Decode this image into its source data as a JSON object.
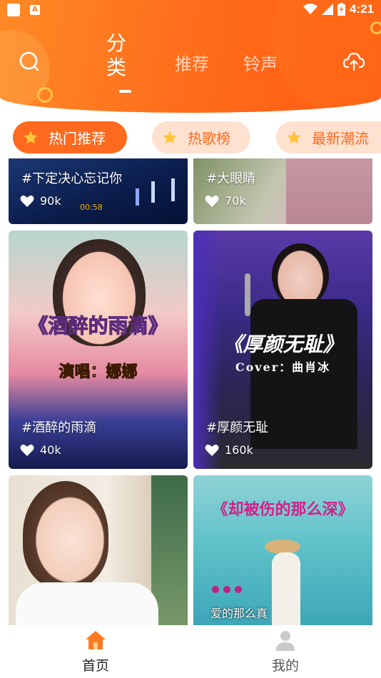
{
  "status_bar": {
    "time": "4:21",
    "notification_icon": "A"
  },
  "header": {
    "tabs": [
      {
        "label": "分类",
        "active": true
      },
      {
        "label": "推荐",
        "active": false
      },
      {
        "label": "铃声",
        "active": false
      }
    ],
    "search_icon": "search-icon",
    "upload_icon": "cloud-upload-icon"
  },
  "chips": [
    {
      "label": "热门推荐",
      "active": true
    },
    {
      "label": "热歌榜",
      "active": false
    },
    {
      "label": "最新潮流",
      "active": false
    }
  ],
  "cards": [
    {
      "caption": "#下定决心忘记你",
      "likes": "90k",
      "overlay": "00:58"
    },
    {
      "caption": "#大眼睛",
      "likes": "70k"
    },
    {
      "caption": "#酒醉的雨滴",
      "likes": "40k",
      "title_overlay": "《酒醉的雨滴》",
      "subtitle_overlay": "演唱：娜娜"
    },
    {
      "caption": "#厚颜无耻",
      "likes": "160k",
      "title_overlay": "《厚颜无耻》",
      "subtitle_overlay": "Cover：曲肖冰"
    },
    {
      "caption": ""
    },
    {
      "caption": "",
      "title_overlay": "《却被伤的那么深》",
      "subtitle_overlay": "爱的那么真"
    }
  ],
  "bottom_nav": [
    {
      "label": "首页",
      "icon": "home-icon",
      "active": true
    },
    {
      "label": "我的",
      "icon": "user-icon",
      "active": false
    }
  ],
  "colors": {
    "accent": "#ff6a1e",
    "chip_inactive_bg": "#ffe1d0",
    "star": "#ffc63a"
  }
}
